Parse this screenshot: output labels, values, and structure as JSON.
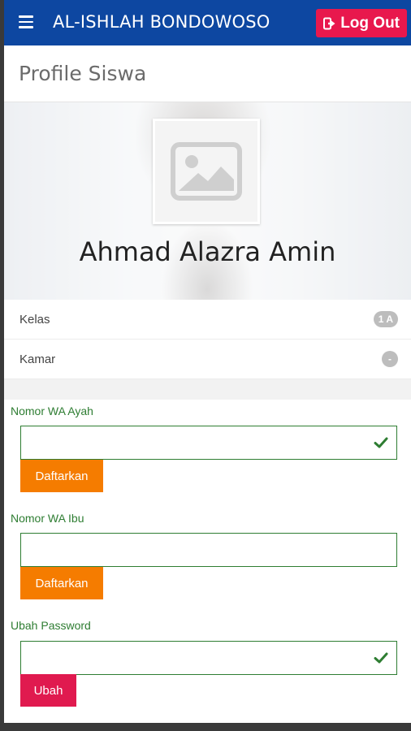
{
  "header": {
    "app_title": "AL-ISHLAH BONDOWOSO",
    "logout_label": "Log Out",
    "accent_color": "#0d47a1",
    "logout_color": "#e8184d"
  },
  "page": {
    "title": "Profile Siswa"
  },
  "profile": {
    "name": "Ahmad Alazra Amin",
    "avatar_icon": "image-placeholder-icon"
  },
  "info": {
    "kelas_label": "Kelas",
    "kelas_value": "1 A",
    "kamar_label": "Kamar",
    "kamar_value": "-"
  },
  "form": {
    "wa_ayah": {
      "label": "Nomor WA Ayah",
      "value": "",
      "button": "Daftarkan",
      "verified": true
    },
    "wa_ibu": {
      "label": "Nomor WA Ibu",
      "value": "",
      "button": "Daftarkan",
      "verified": false
    },
    "password": {
      "label": "Ubah Password",
      "value": "",
      "button": "Ubah",
      "verified": true
    }
  }
}
